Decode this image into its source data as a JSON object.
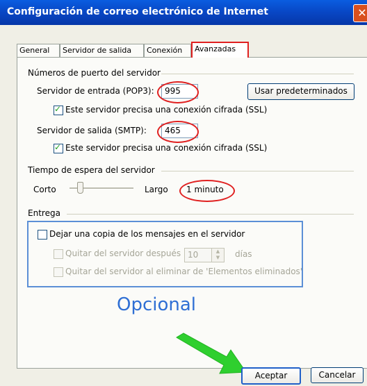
{
  "window": {
    "title": "Configuración de correo electrónico de Internet",
    "close_glyph": "✕"
  },
  "tabs": [
    {
      "label": "General"
    },
    {
      "label": "Servidor de salida"
    },
    {
      "label": "Conexión"
    },
    {
      "label": "Avanzadas",
      "active": true
    }
  ],
  "ports": {
    "header": "Números de puerto del servidor",
    "incoming_label": "Servidor de entrada (POP3):",
    "incoming_value": "995",
    "defaults_button": "Usar predeterminados",
    "incoming_ssl_label": "Este servidor precisa una conexión cifrada (SSL)",
    "incoming_ssl_checked": true,
    "outgoing_label": "Servidor de salida (SMTP):",
    "outgoing_value": "465",
    "outgoing_ssl_label": "Este servidor precisa una conexión cifrada (SSL)",
    "outgoing_ssl_checked": true
  },
  "timeout": {
    "header": "Tiempo de espera del servidor",
    "short_label": "Corto",
    "long_label": "Largo",
    "value_text": "1 minuto",
    "slider_level": 0.12
  },
  "delivery": {
    "header": "Entrega",
    "leave_copy_label": "Dejar una copia de los mensajes en el servidor",
    "leave_copy_checked": false,
    "remove_after_label": "Quitar del servidor después",
    "remove_after_days": "10",
    "days_label": "días",
    "remove_on_delete_label": "Quitar del servidor al eliminar de 'Elementos eliminados'"
  },
  "annotation": {
    "optional_text": "Opcional",
    "highlight_color": "#e02020",
    "box_color": "#5b8fd6",
    "arrow_color": "#2fcf2f"
  },
  "footer": {
    "ok_button": "Aceptar",
    "cancel_button": "Cancelar"
  }
}
